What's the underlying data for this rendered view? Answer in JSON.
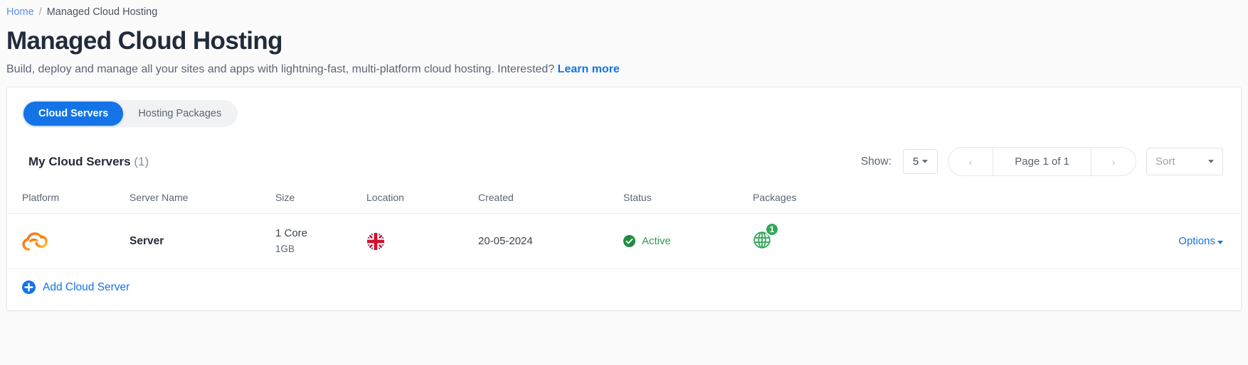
{
  "breadcrumb": {
    "home": "Home",
    "separator": "/",
    "current": "Managed Cloud Hosting"
  },
  "header": {
    "title": "Managed Cloud Hosting",
    "subtitle": "Build, deploy and manage all your sites and apps with lightning-fast, multi-platform cloud hosting. Interested?",
    "learn_more": "Learn more"
  },
  "tabs": [
    {
      "label": "Cloud Servers",
      "active": true
    },
    {
      "label": "Hosting Packages",
      "active": false
    }
  ],
  "section": {
    "title": "My Cloud Servers",
    "count": "(1)"
  },
  "toolbar": {
    "show_label": "Show:",
    "show_value": "5",
    "pager": {
      "prev": "‹",
      "page_text": "Page 1 of 1",
      "next": "›"
    },
    "sort_placeholder": "Sort"
  },
  "table": {
    "columns": [
      "Platform",
      "Server Name",
      "Size",
      "Location",
      "Created",
      "Status",
      "Packages",
      ""
    ],
    "rows": [
      {
        "platform_icon": "cloud-platform-icon",
        "server_name": "Server",
        "size_cores": "1 Core",
        "size_memory": "1GB",
        "location_icon": "uk-flag-icon",
        "location_name": "United Kingdom",
        "created": "20-05-2024",
        "status": "Active",
        "status_icon": "check-circle-icon",
        "packages_icon": "globe-icon",
        "packages_count": "1",
        "options_label": "Options"
      }
    ]
  },
  "footer": {
    "add_label": "Add Cloud Server",
    "add_icon": "plus-circle-icon"
  },
  "colors": {
    "accent_blue": "#1473e6",
    "link_blue": "#5b8def",
    "status_green": "#2e9e4f",
    "badge_green": "#35a85a",
    "platform_orange": "#f58220",
    "platform_yellow": "#fdc130",
    "page_bg": "#fbfbfc",
    "card_bg": "#ffffff",
    "border": "#e7e9ed"
  }
}
